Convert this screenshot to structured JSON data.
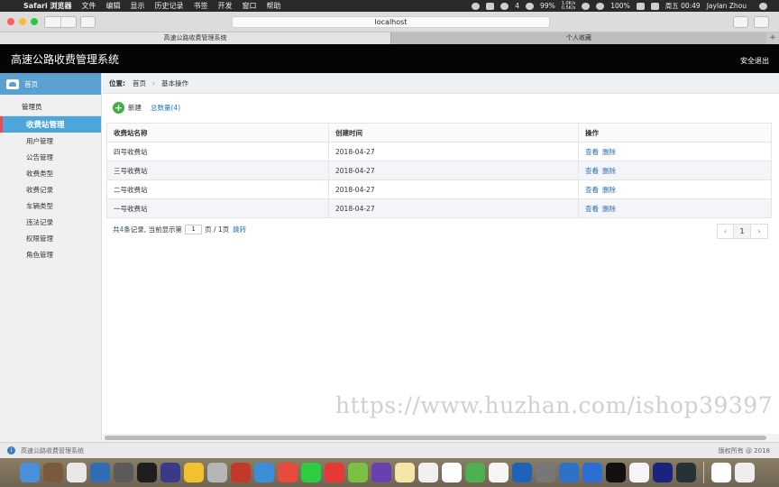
{
  "menubar": {
    "app_name": "Safari 浏览器",
    "menus": [
      "文件",
      "编辑",
      "显示",
      "历史记录",
      "书签",
      "开发",
      "窗口",
      "帮助"
    ],
    "wechat_count": "4",
    "battery": "99%",
    "net_up": "1.0K/s",
    "net_down": "0.5K/s",
    "battery2": "100%",
    "clock": "周五 00:49",
    "user": "Jaylan Zhou"
  },
  "browser": {
    "url": "localhost",
    "tabs": [
      {
        "label": "高速公路收费管理系统"
      },
      {
        "label": "个人收藏"
      }
    ]
  },
  "app": {
    "title": "高速公路收费管理系统",
    "logout": "安全退出"
  },
  "sidebar": {
    "home": "首页",
    "section": "管理员",
    "items": [
      {
        "label": "收费站管理"
      },
      {
        "label": "用户管理"
      },
      {
        "label": "公告管理"
      },
      {
        "label": "收费类型"
      },
      {
        "label": "收费记录"
      },
      {
        "label": "车辆类型"
      },
      {
        "label": "违法记录"
      },
      {
        "label": "权限管理"
      },
      {
        "label": "角色管理"
      }
    ]
  },
  "breadcrumb": {
    "label": "位置:",
    "home": "首页",
    "current": "基本操作"
  },
  "toolbar": {
    "new_label": "新建",
    "total_label": "总数量(4)"
  },
  "table": {
    "headers": [
      "收费站名称",
      "创建时间",
      "操作"
    ],
    "rows": [
      {
        "name": "四号收费站",
        "date": "2018-04-27",
        "view": "查看",
        "del": "删除"
      },
      {
        "name": "三号收费站",
        "date": "2018-04-27",
        "view": "查看",
        "del": "删除"
      },
      {
        "name": "二号收费站",
        "date": "2018-04-27",
        "view": "查看",
        "del": "删除"
      },
      {
        "name": "一号收费站",
        "date": "2018-04-27",
        "view": "查看",
        "del": "删除"
      }
    ]
  },
  "pagination": {
    "summary_pre": "共",
    "total": "4",
    "summary_mid": "条记录,  当前显示第",
    "page_input": "1",
    "summary_post": "页 / 1页",
    "jump": "跳转",
    "current_page": "1"
  },
  "watermark": "https://www.huzhan.com/ishop39397",
  "status": {
    "left": "高速公路收费管理系统",
    "right": "版权所有 @ 2018"
  },
  "dock_colors": [
    "#4a90d9",
    "#7a5a3a",
    "#e8e8e8",
    "#2f6db5",
    "#5b5b5b",
    "#1e1e1e",
    "#3a3a8a",
    "#f2c12e",
    "#b5b5b5",
    "#c0392b",
    "#3b8fd8",
    "#e74c3c",
    "#2ecc40",
    "#e53935",
    "#7ac143",
    "#6a3fb0",
    "#f5e6a8",
    "#f0f0f0",
    "#ffffff",
    "#4caf50",
    "#f5f5f5",
    "#1e63b8",
    "#777777",
    "#2c72c7",
    "#2d6ed5",
    "#111111",
    "#f5f5f5",
    "#1a237e",
    "#263238",
    "#ffffff",
    "#eeeeee"
  ]
}
